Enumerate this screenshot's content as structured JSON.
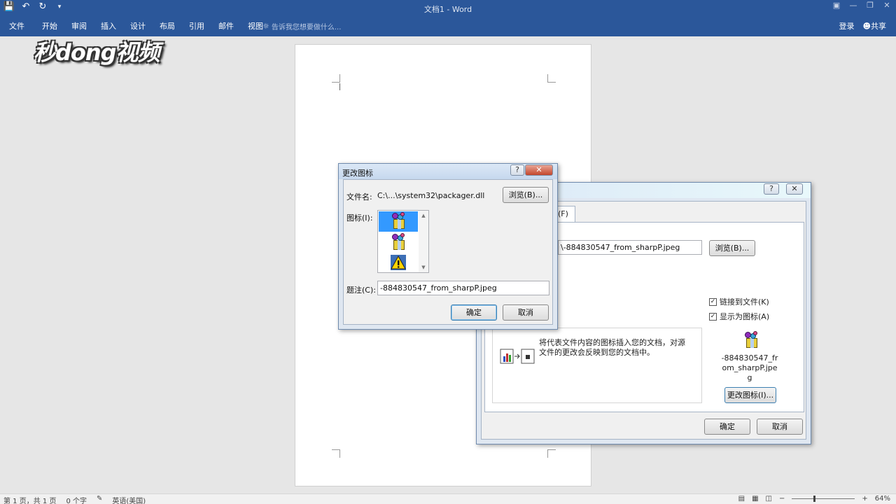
{
  "app": {
    "title": "文档1 - Word",
    "qat": {
      "save_icon": "save-icon",
      "undo_icon": "undo-icon",
      "redo_icon": "redo-icon",
      "customize_icon": "customize-qat-icon"
    },
    "window_buttons": [
      "ribbon-options-icon",
      "minimize-icon",
      "restore-icon",
      "close-icon"
    ],
    "tabs": [
      "文件",
      "开始",
      "审阅",
      "插入",
      "设计",
      "布局",
      "引用",
      "邮件",
      "视图"
    ],
    "tell_me": "告诉我您想要做什么...",
    "signin": "登录",
    "share": "共享",
    "accent": "#2b579a"
  },
  "watermark": "秒dong视频",
  "statusbar": {
    "page": "第 1 页，共 1 页",
    "words": "0 个字",
    "language": "英语(美国)",
    "zoom": "64%",
    "zoom_fraction": 0.35
  },
  "object_dialog": {
    "tab_label": "(F)",
    "file_path": "\\-884830547_from_sharpP.jpeg",
    "browse_button": "浏览(B)...",
    "link_to_file": "链接到文件(K)",
    "link_to_file_checked": true,
    "display_as_icon": "显示为图标(A)",
    "display_as_icon_checked": true,
    "result_description": "将代表文件内容的图标插入您的文档，对源文件的更改会反映到您的文档中。",
    "icon_caption": "-884830547_from_sharpP.jpeg",
    "change_icon_button": "更改图标(I)...",
    "ok": "确定",
    "cancel": "取消"
  },
  "change_icon_dialog": {
    "title": "更改图标",
    "help_button": "?",
    "filename_label": "文件名:",
    "filename_value": "C:\\...\\system32\\packager.dll",
    "browse_button": "浏览(B)...",
    "icon_label": "图标(I):",
    "icons": [
      "package-icon",
      "package-icon",
      "warning-icon"
    ],
    "selected_index": 0,
    "caption_label": "题注(C):",
    "caption_value": "-884830547_from_sharpP.jpeg",
    "ok": "确定",
    "cancel": "取消"
  }
}
